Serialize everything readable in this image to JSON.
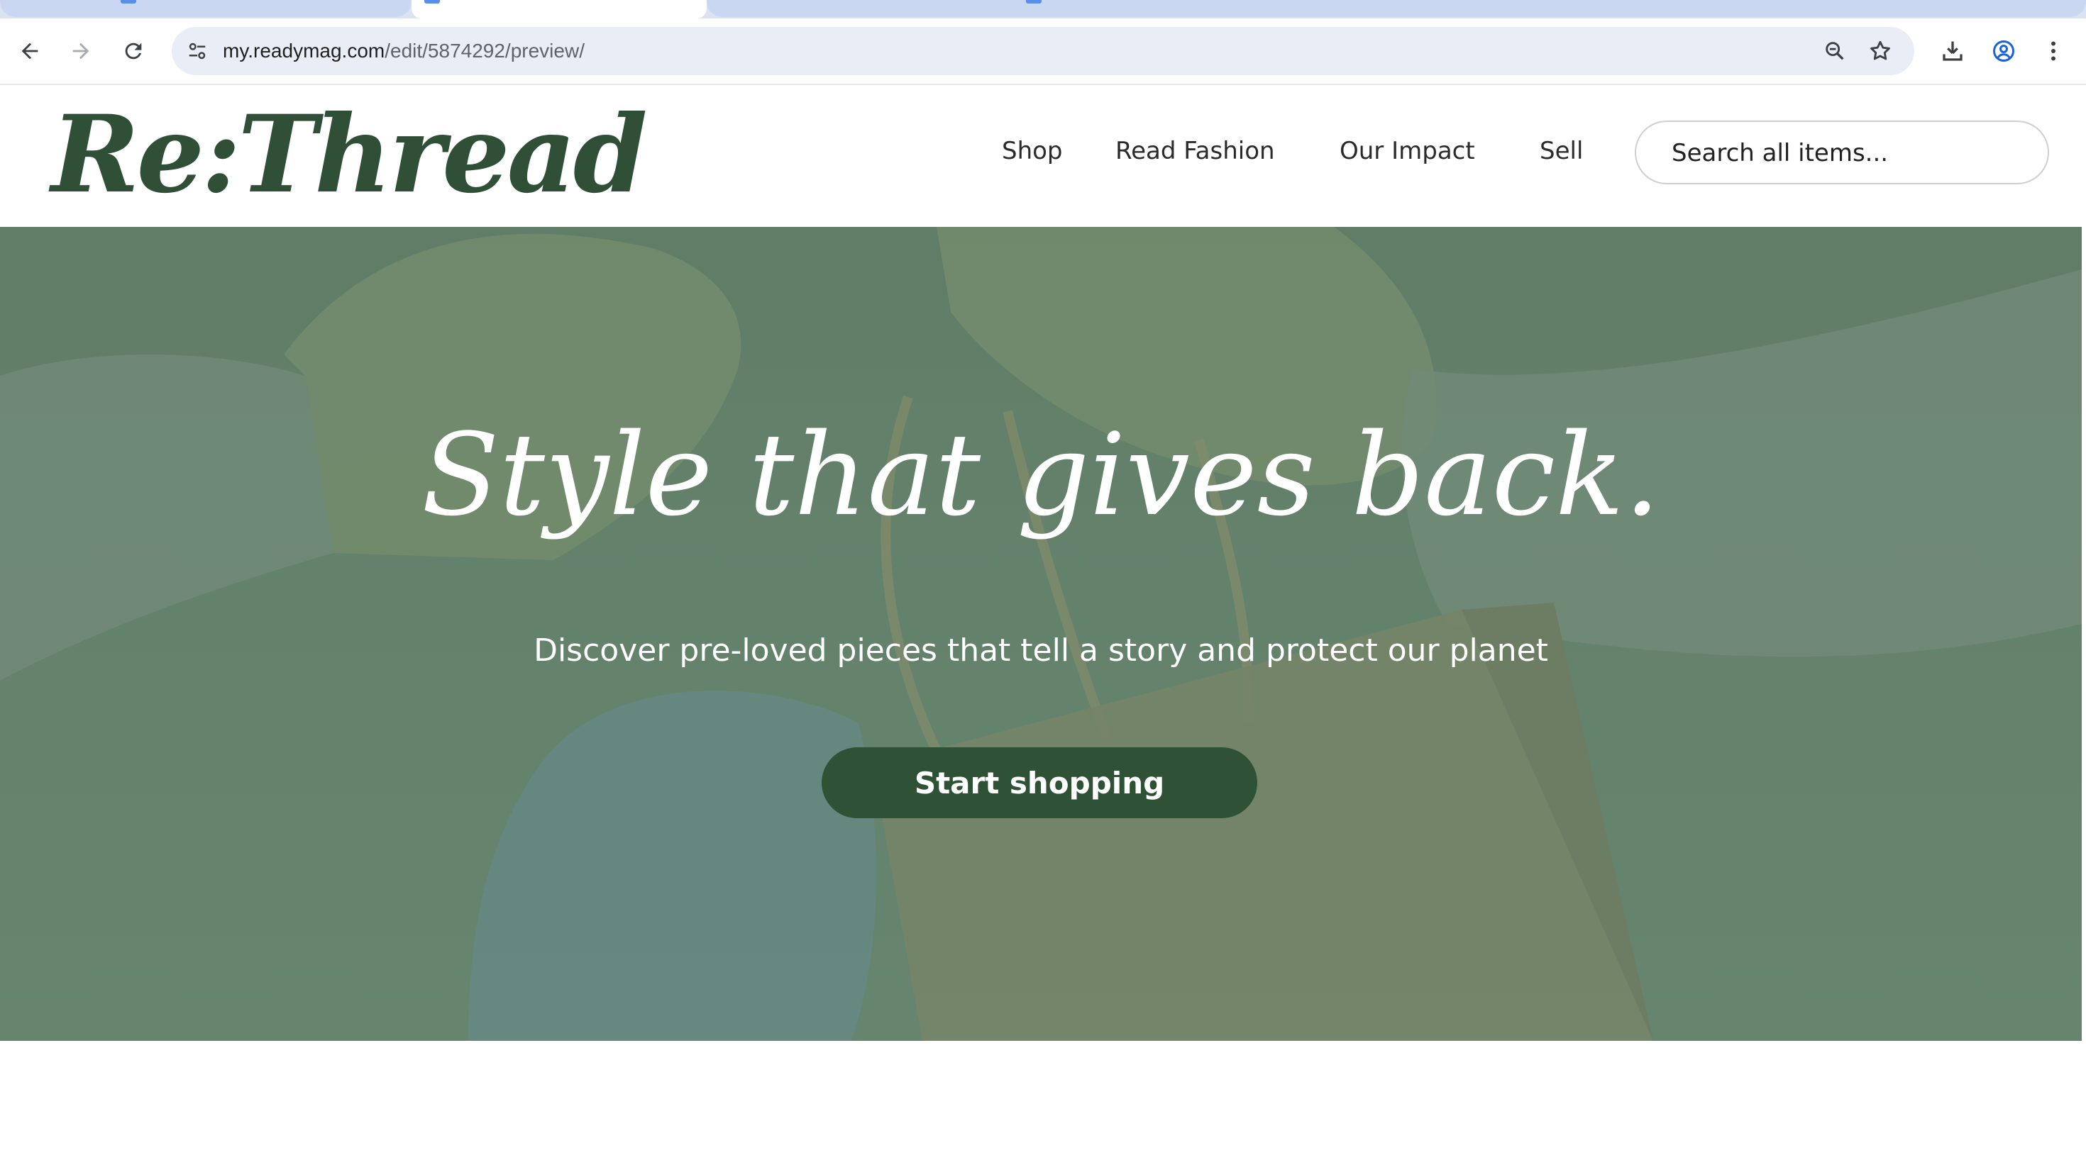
{
  "browser": {
    "url_host": "my.readymag.com",
    "url_path": "/edit/5874292/preview/"
  },
  "site": {
    "logo": "Re:Thread",
    "nav": [
      {
        "label": "Shop"
      },
      {
        "label": "Read Fashion"
      },
      {
        "label": "Our Impact"
      },
      {
        "label": "Sell"
      }
    ],
    "search_placeholder": "Search all items..."
  },
  "hero": {
    "headline": "Style that gives back.",
    "subline": "Discover pre-loved pieces that tell a story and protect our planet",
    "cta_label": "Start shopping"
  },
  "colors": {
    "brand_green": "#2f5236",
    "logo_green": "#2f4f36",
    "hero_tint": "#6a8772"
  },
  "icons": {
    "back": "arrow-left-icon",
    "forward": "arrow-right-icon",
    "reload": "reload-icon",
    "site_info": "tune-icon",
    "zoom": "zoom-out-icon",
    "bookmark": "star-icon",
    "download": "download-icon",
    "profile": "account-circle-icon",
    "menu": "kebab-menu-icon"
  }
}
